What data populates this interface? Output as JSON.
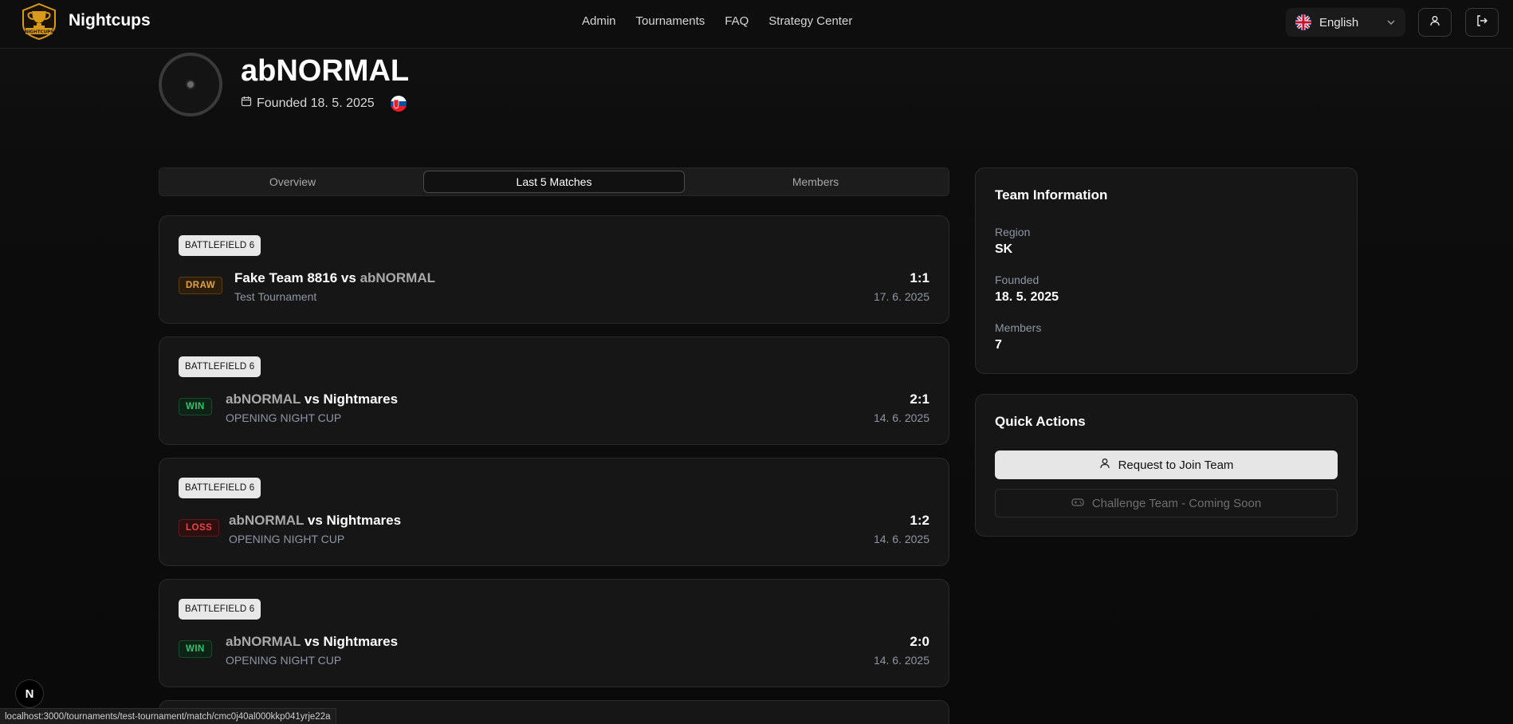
{
  "navbar": {
    "brand": "Nightcups",
    "logo_text": "NIGHTCUPS",
    "links": [
      "Admin",
      "Tournaments",
      "FAQ",
      "Strategy Center"
    ],
    "language": "English",
    "language_flag": "uk-flag-icon",
    "profile_icon": "user-icon",
    "logout_icon": "logout-icon"
  },
  "team": {
    "name": "abNORMAL",
    "founded": "Founded 18. 5. 2025",
    "country_flag": "slovakia-flag-icon"
  },
  "tabs": [
    {
      "label": "Overview",
      "active": false
    },
    {
      "label": "Last 5 Matches",
      "active": true
    },
    {
      "label": "Members",
      "active": false
    }
  ],
  "matches": [
    {
      "game": "BATTLEFIELD 6",
      "result": "DRAW",
      "team1": "Fake Team 8816",
      "vs": "vs",
      "team2": "abNORMAL",
      "tournament": "Test Tournament",
      "score": "1:1",
      "date": "17. 6. 2025"
    },
    {
      "game": "BATTLEFIELD 6",
      "result": "WIN",
      "team1": "abNORMAL",
      "vs": "vs",
      "team2": "Nightmares",
      "tournament": "OPENING NIGHT CUP",
      "score": "2:1",
      "date": "14. 6. 2025"
    },
    {
      "game": "BATTLEFIELD 6",
      "result": "LOSS",
      "team1": "abNORMAL",
      "vs": "vs",
      "team2": "Nightmares",
      "tournament": "OPENING NIGHT CUP",
      "score": "1:2",
      "date": "14. 6. 2025"
    },
    {
      "game": "BATTLEFIELD 6",
      "result": "WIN",
      "team1": "abNORMAL",
      "vs": "vs",
      "team2": "Nightmares",
      "tournament": "OPENING NIGHT CUP",
      "score": "2:0",
      "date": "14. 6. 2025"
    }
  ],
  "team_info": {
    "title": "Team Information",
    "region_label": "Region",
    "region": "SK",
    "founded_label": "Founded",
    "founded": "18. 5. 2025",
    "members_label": "Members",
    "members": "7"
  },
  "quick_actions": {
    "title": "Quick Actions",
    "join_label": "Request to Join Team",
    "challenge_label": "Challenge Team - Coming Soon"
  },
  "dev_badge": "N",
  "status_url": "localhost:3000/tournaments/test-tournament/match/cmc0j40al000kkp041yrje22a",
  "colors": {
    "background": "#0b0b0b",
    "card": "#161616",
    "draw": "#e6a33a",
    "win": "#2ec56b",
    "loss": "#e84545",
    "logo_gold": "#d99a1c"
  }
}
